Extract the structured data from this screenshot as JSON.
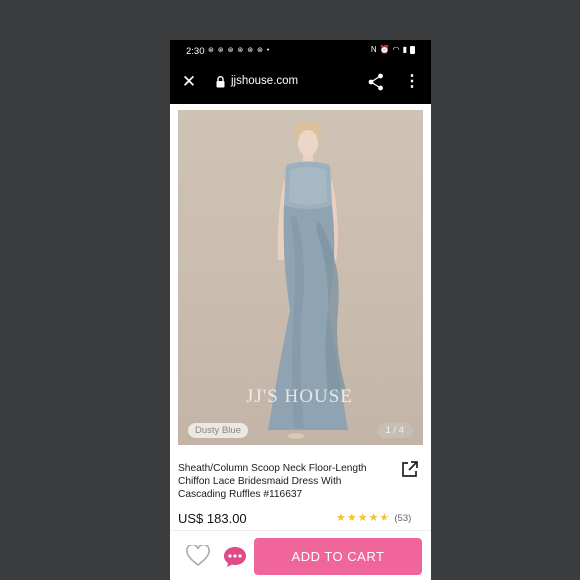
{
  "status_bar": {
    "time": "2:30",
    "notifications": "⊛ ⊛ ⊛ ⊛ ⊛ ⊛ •"
  },
  "browser": {
    "url": "jjshouse.com",
    "close_icon": "close-icon",
    "lock_icon": "lock-icon",
    "share_icon": "share-icon",
    "menu_icon": "more-vertical-icon"
  },
  "product": {
    "watermark": "JJ'S HOUSE",
    "color_tag": "Dusty Blue",
    "image_counter": "1 / 4",
    "title": "Sheath/Column Scoop Neck Floor-Length Chiffon Lace Bridesmaid Dress With Cascading Ruffles #116637",
    "price": "US$ 183.00",
    "rating": 4.5,
    "review_count": "(53)"
  },
  "actions": {
    "add_to_cart": "ADD TO CART"
  },
  "colors": {
    "accent": "#f0669b",
    "chat_icon": "#e04a86",
    "dress": "#8fa3b3",
    "background": "#3b3c3e",
    "star": "#f2c02c"
  }
}
